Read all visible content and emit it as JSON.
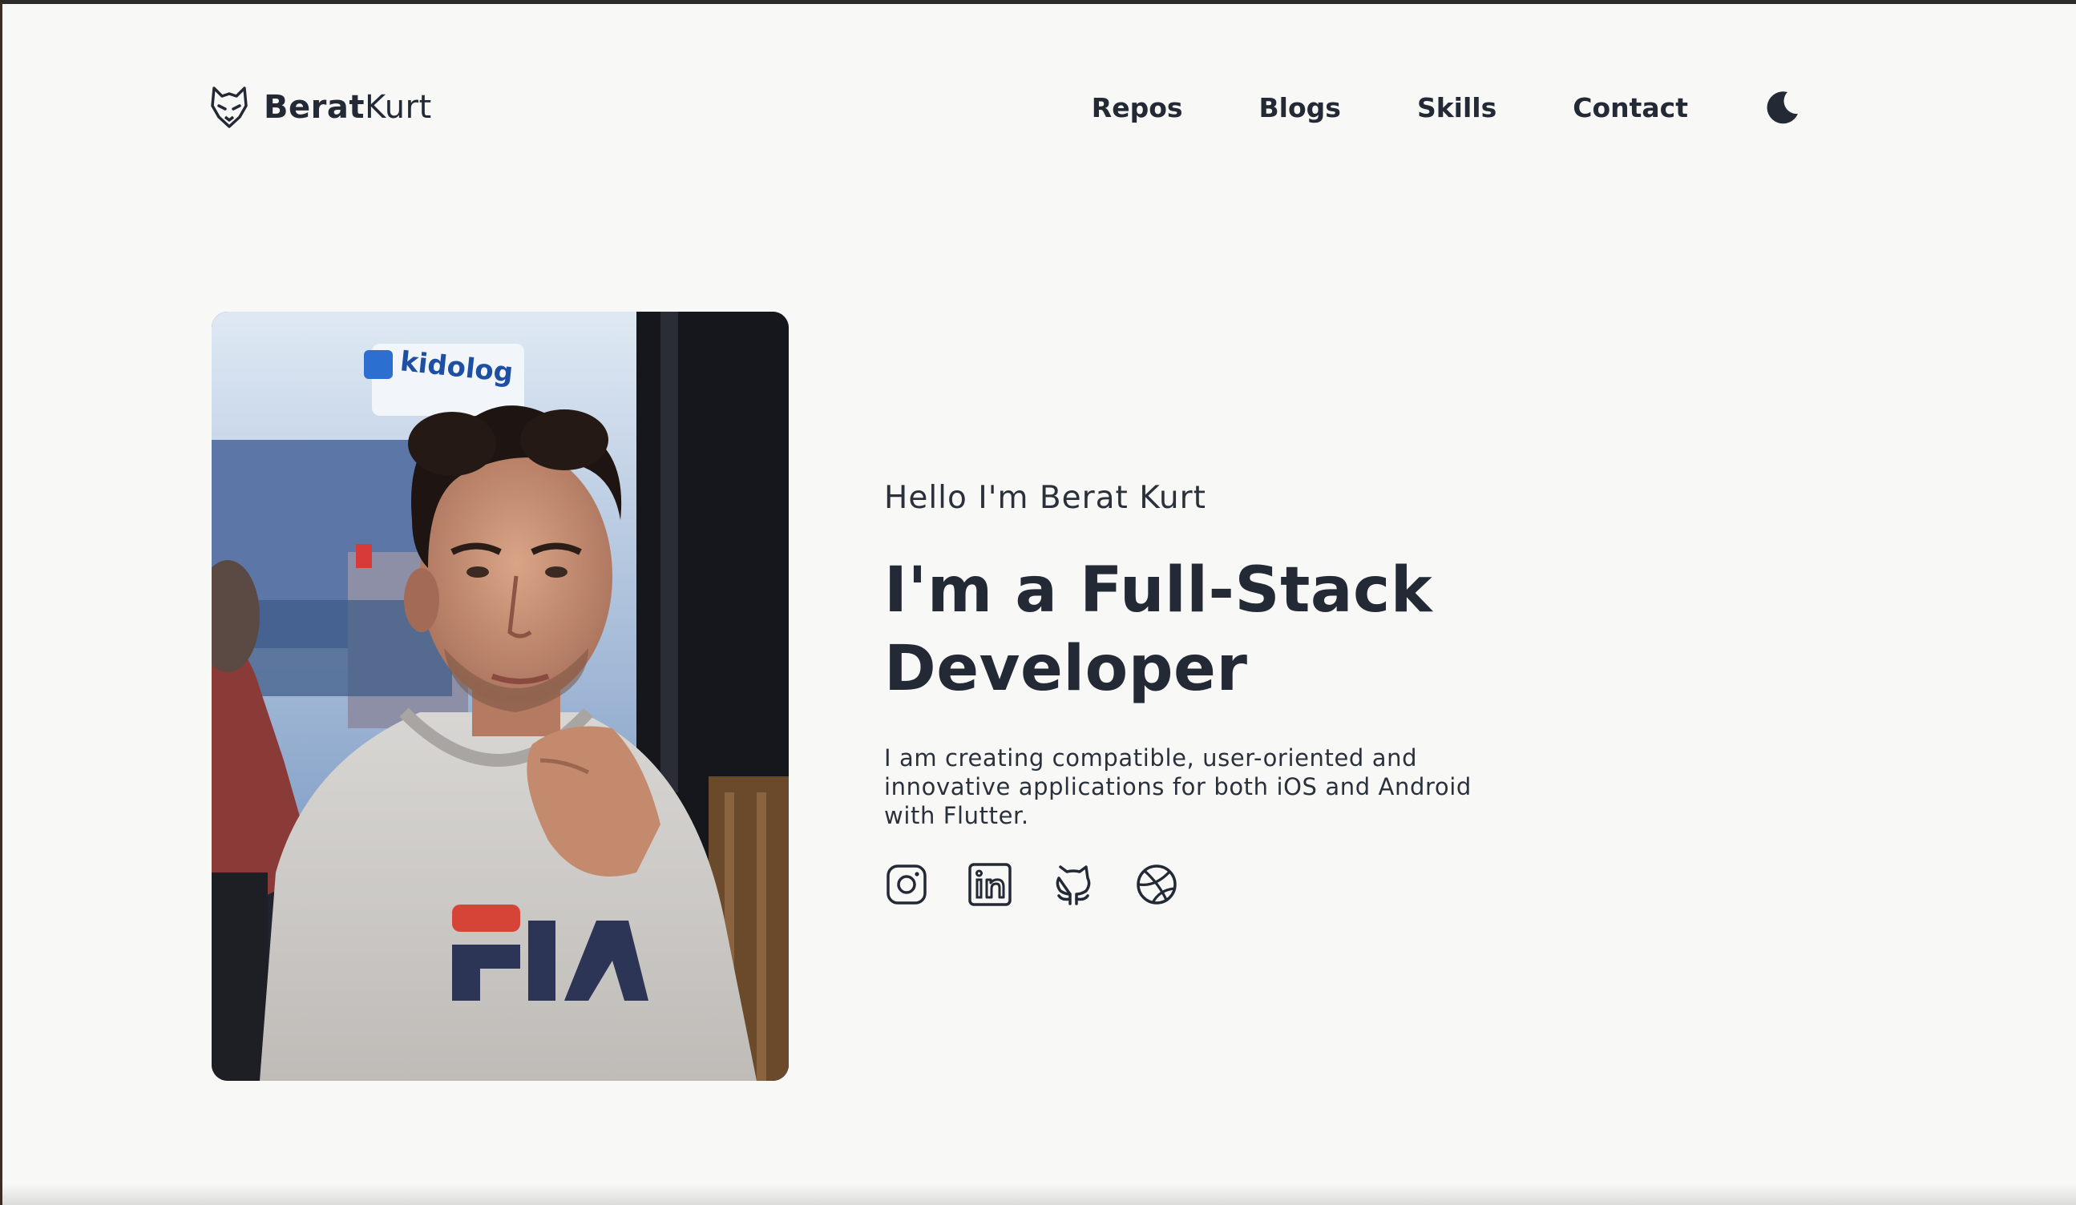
{
  "brand": {
    "first": "Berat",
    "last": "Kurt",
    "icon": "fox-logo-icon"
  },
  "nav": {
    "items": [
      {
        "label": "Repos"
      },
      {
        "label": "Blogs"
      },
      {
        "label": "Skills"
      },
      {
        "label": "Contact"
      }
    ],
    "theme_toggle_icon": "moon-icon"
  },
  "hero": {
    "greeting": "Hello I'm Berat Kurt",
    "headline_line1": "I'm a Full-Stack",
    "headline_line2": "Developer",
    "description": "I am creating compatible, user-oriented and innovative applications for both iOS and Android with Flutter.",
    "photo_sign_text": "kidolog",
    "socials": [
      {
        "icon": "instagram-icon"
      },
      {
        "icon": "linkedin-icon"
      },
      {
        "icon": "github-icon"
      },
      {
        "icon": "dribbble-icon"
      }
    ]
  },
  "colors": {
    "background": "#f8f8f6",
    "text": "#232a35"
  }
}
